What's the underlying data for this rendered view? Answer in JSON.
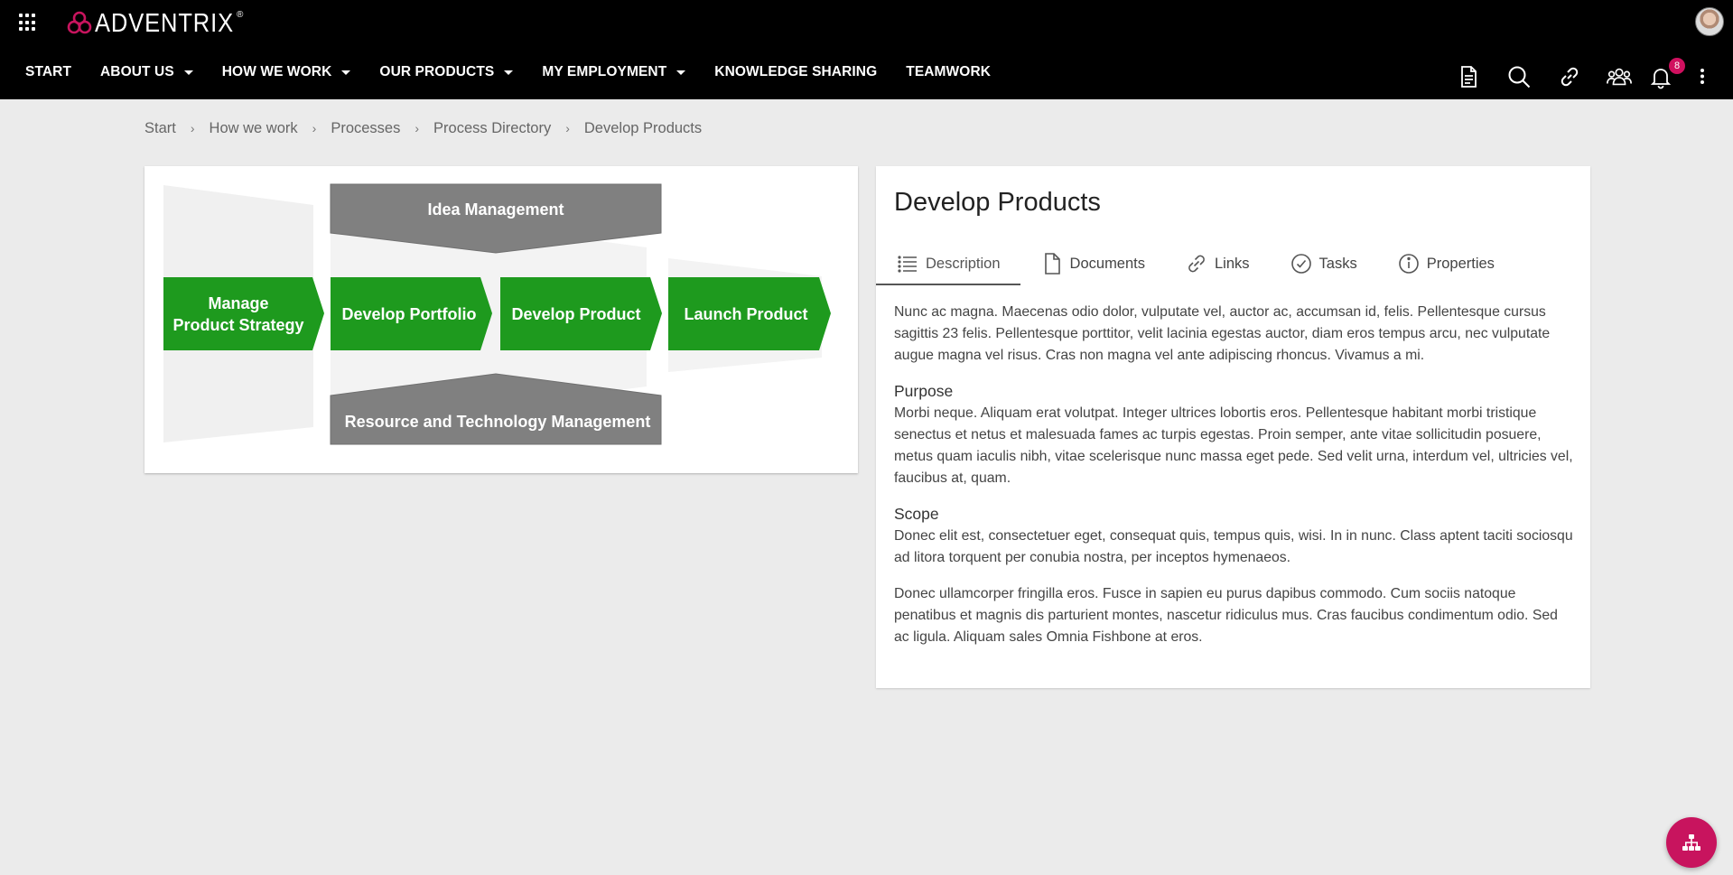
{
  "app": {
    "logo_text": "ADVENTRIX",
    "logo_reg": "®",
    "brand_color": "#c8145e"
  },
  "nav": {
    "items": [
      {
        "label": "START"
      },
      {
        "label": "ABOUT US"
      },
      {
        "label": "HOW WE WORK"
      },
      {
        "label": "OUR PRODUCTS"
      },
      {
        "label": "MY EMPLOYMENT"
      },
      {
        "label": "KNOWLEDGE SHARING"
      },
      {
        "label": "TEAMWORK"
      }
    ]
  },
  "toolbar": {
    "icons": [
      "document-icon",
      "search-icon",
      "link-icon",
      "team-icon",
      "bell-icon",
      "more-vertical-icon"
    ],
    "notification_count": "8"
  },
  "breadcrumb": [
    "Start",
    "How we work",
    "Processes",
    "Process Directory",
    "Develop Products"
  ],
  "process_map": {
    "top": "Idea Management",
    "bottom": "Resource and Technology Management",
    "steps": [
      {
        "line1": "Manage",
        "line2": "Product Strategy"
      },
      {
        "line1": "Develop Portfolio",
        "line2": ""
      },
      {
        "line1": "Develop Product",
        "line2": ""
      },
      {
        "line1": "Launch Product",
        "line2": ""
      }
    ],
    "step_color": "#1e9a1e",
    "support_color": "#808080"
  },
  "detail": {
    "title": "Develop Products",
    "tabs": [
      {
        "label": "Description",
        "icon": "list-icon"
      },
      {
        "label": "Documents",
        "icon": "document-icon"
      },
      {
        "label": "Links",
        "icon": "link-icon"
      },
      {
        "label": "Tasks",
        "icon": "check-circle-icon"
      },
      {
        "label": "Properties",
        "icon": "info-icon"
      }
    ],
    "intro": "Nunc ac magna. Maecenas odio dolor, vulputate vel, auctor ac, accumsan id, felis. Pellentesque cursus sagittis 23 felis. Pellentesque porttitor, velit lacinia egestas auctor, diam eros tempus arcu, nec vulputate augue magna vel risus. Cras non magna vel ante adipiscing rhoncus. Vivamus a mi.",
    "purpose_heading": "Purpose",
    "purpose_text": "Morbi neque. Aliquam erat volutpat. Integer ultrices lobortis eros. Pellentesque habitant morbi tristique senectus et netus et malesuada fames ac turpis egestas. Proin semper, ante vitae sollicitudin posuere, metus quam iaculis nibh, vitae scelerisque nunc massa eget pede. Sed velit urna, interdum vel, ultricies vel, faucibus at, quam.",
    "scope_heading": "Scope",
    "scope_text": "Donec elit est, consectetuer eget, consequat quis, tempus quis, wisi. In in nunc. Class aptent taciti sociosqu ad litora torquent per conubia nostra, per inceptos hymenaeos.",
    "closing_text": "Donec ullamcorper fringilla eros. Fusce in sapien eu purus dapibus commodo. Cum sociis natoque penatibus et magnis dis parturient montes, nascetur ridiculus mus. Cras faucibus condimentum odio. Sed ac ligula. Aliquam sales Omnia Fishbone at eros."
  }
}
